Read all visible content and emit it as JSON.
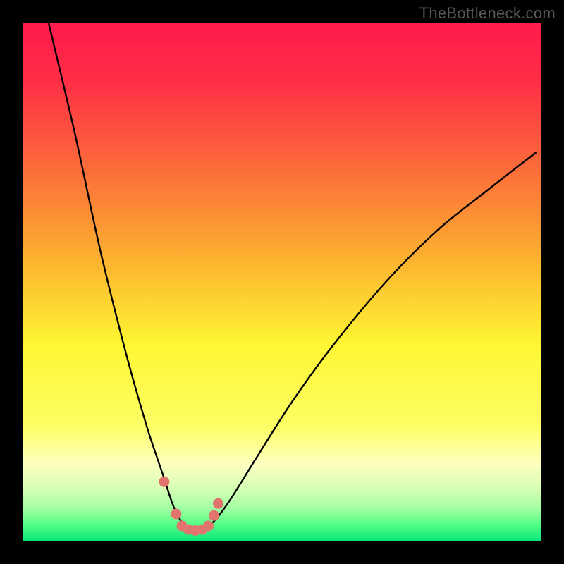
{
  "watermark": "TheBottleneck.com",
  "colors": {
    "bg": "#000000",
    "curve": "#000000",
    "dot_fill": "#e2746e",
    "gradient_stops": [
      {
        "pct": 0,
        "color": "#ff1a4c"
      },
      {
        "pct": 11,
        "color": "#ff2d46"
      },
      {
        "pct": 28,
        "color": "#fc6b3a"
      },
      {
        "pct": 46,
        "color": "#fcb32f"
      },
      {
        "pct": 62,
        "color": "#fff633"
      },
      {
        "pct": 78,
        "color": "#fcff66"
      },
      {
        "pct": 85,
        "color": "#feffbf"
      },
      {
        "pct": 90,
        "color": "#d4ffb5"
      },
      {
        "pct": 94,
        "color": "#9cffa1"
      },
      {
        "pct": 97,
        "color": "#4cfd83"
      },
      {
        "pct": 100,
        "color": "#06e47a"
      }
    ]
  },
  "chart_data": {
    "type": "line",
    "title": "",
    "xlabel": "",
    "ylabel": "",
    "xlim": [
      0,
      100
    ],
    "ylim": [
      0,
      100
    ],
    "series": [
      {
        "name": "bottleneck-curve",
        "x": [
          5,
          10,
          15,
          20,
          24,
          27,
          29,
          30.5,
          32,
          33.5,
          35,
          37,
          40,
          45,
          52,
          60,
          70,
          80,
          90,
          99
        ],
        "values": [
          100,
          79,
          56,
          36,
          22,
          13,
          7,
          4,
          2.5,
          2,
          2.5,
          4,
          8,
          16,
          27,
          38,
          50,
          60,
          68,
          75
        ]
      }
    ],
    "dots": {
      "name": "highlight-dots",
      "x": [
        27.3,
        29.6,
        30.7,
        32.0,
        33.3,
        34.6,
        35.8,
        36.9,
        37.7
      ],
      "values": [
        11.5,
        5.3,
        3.0,
        2.3,
        2.1,
        2.3,
        3.0,
        5.0,
        7.3
      ]
    }
  }
}
